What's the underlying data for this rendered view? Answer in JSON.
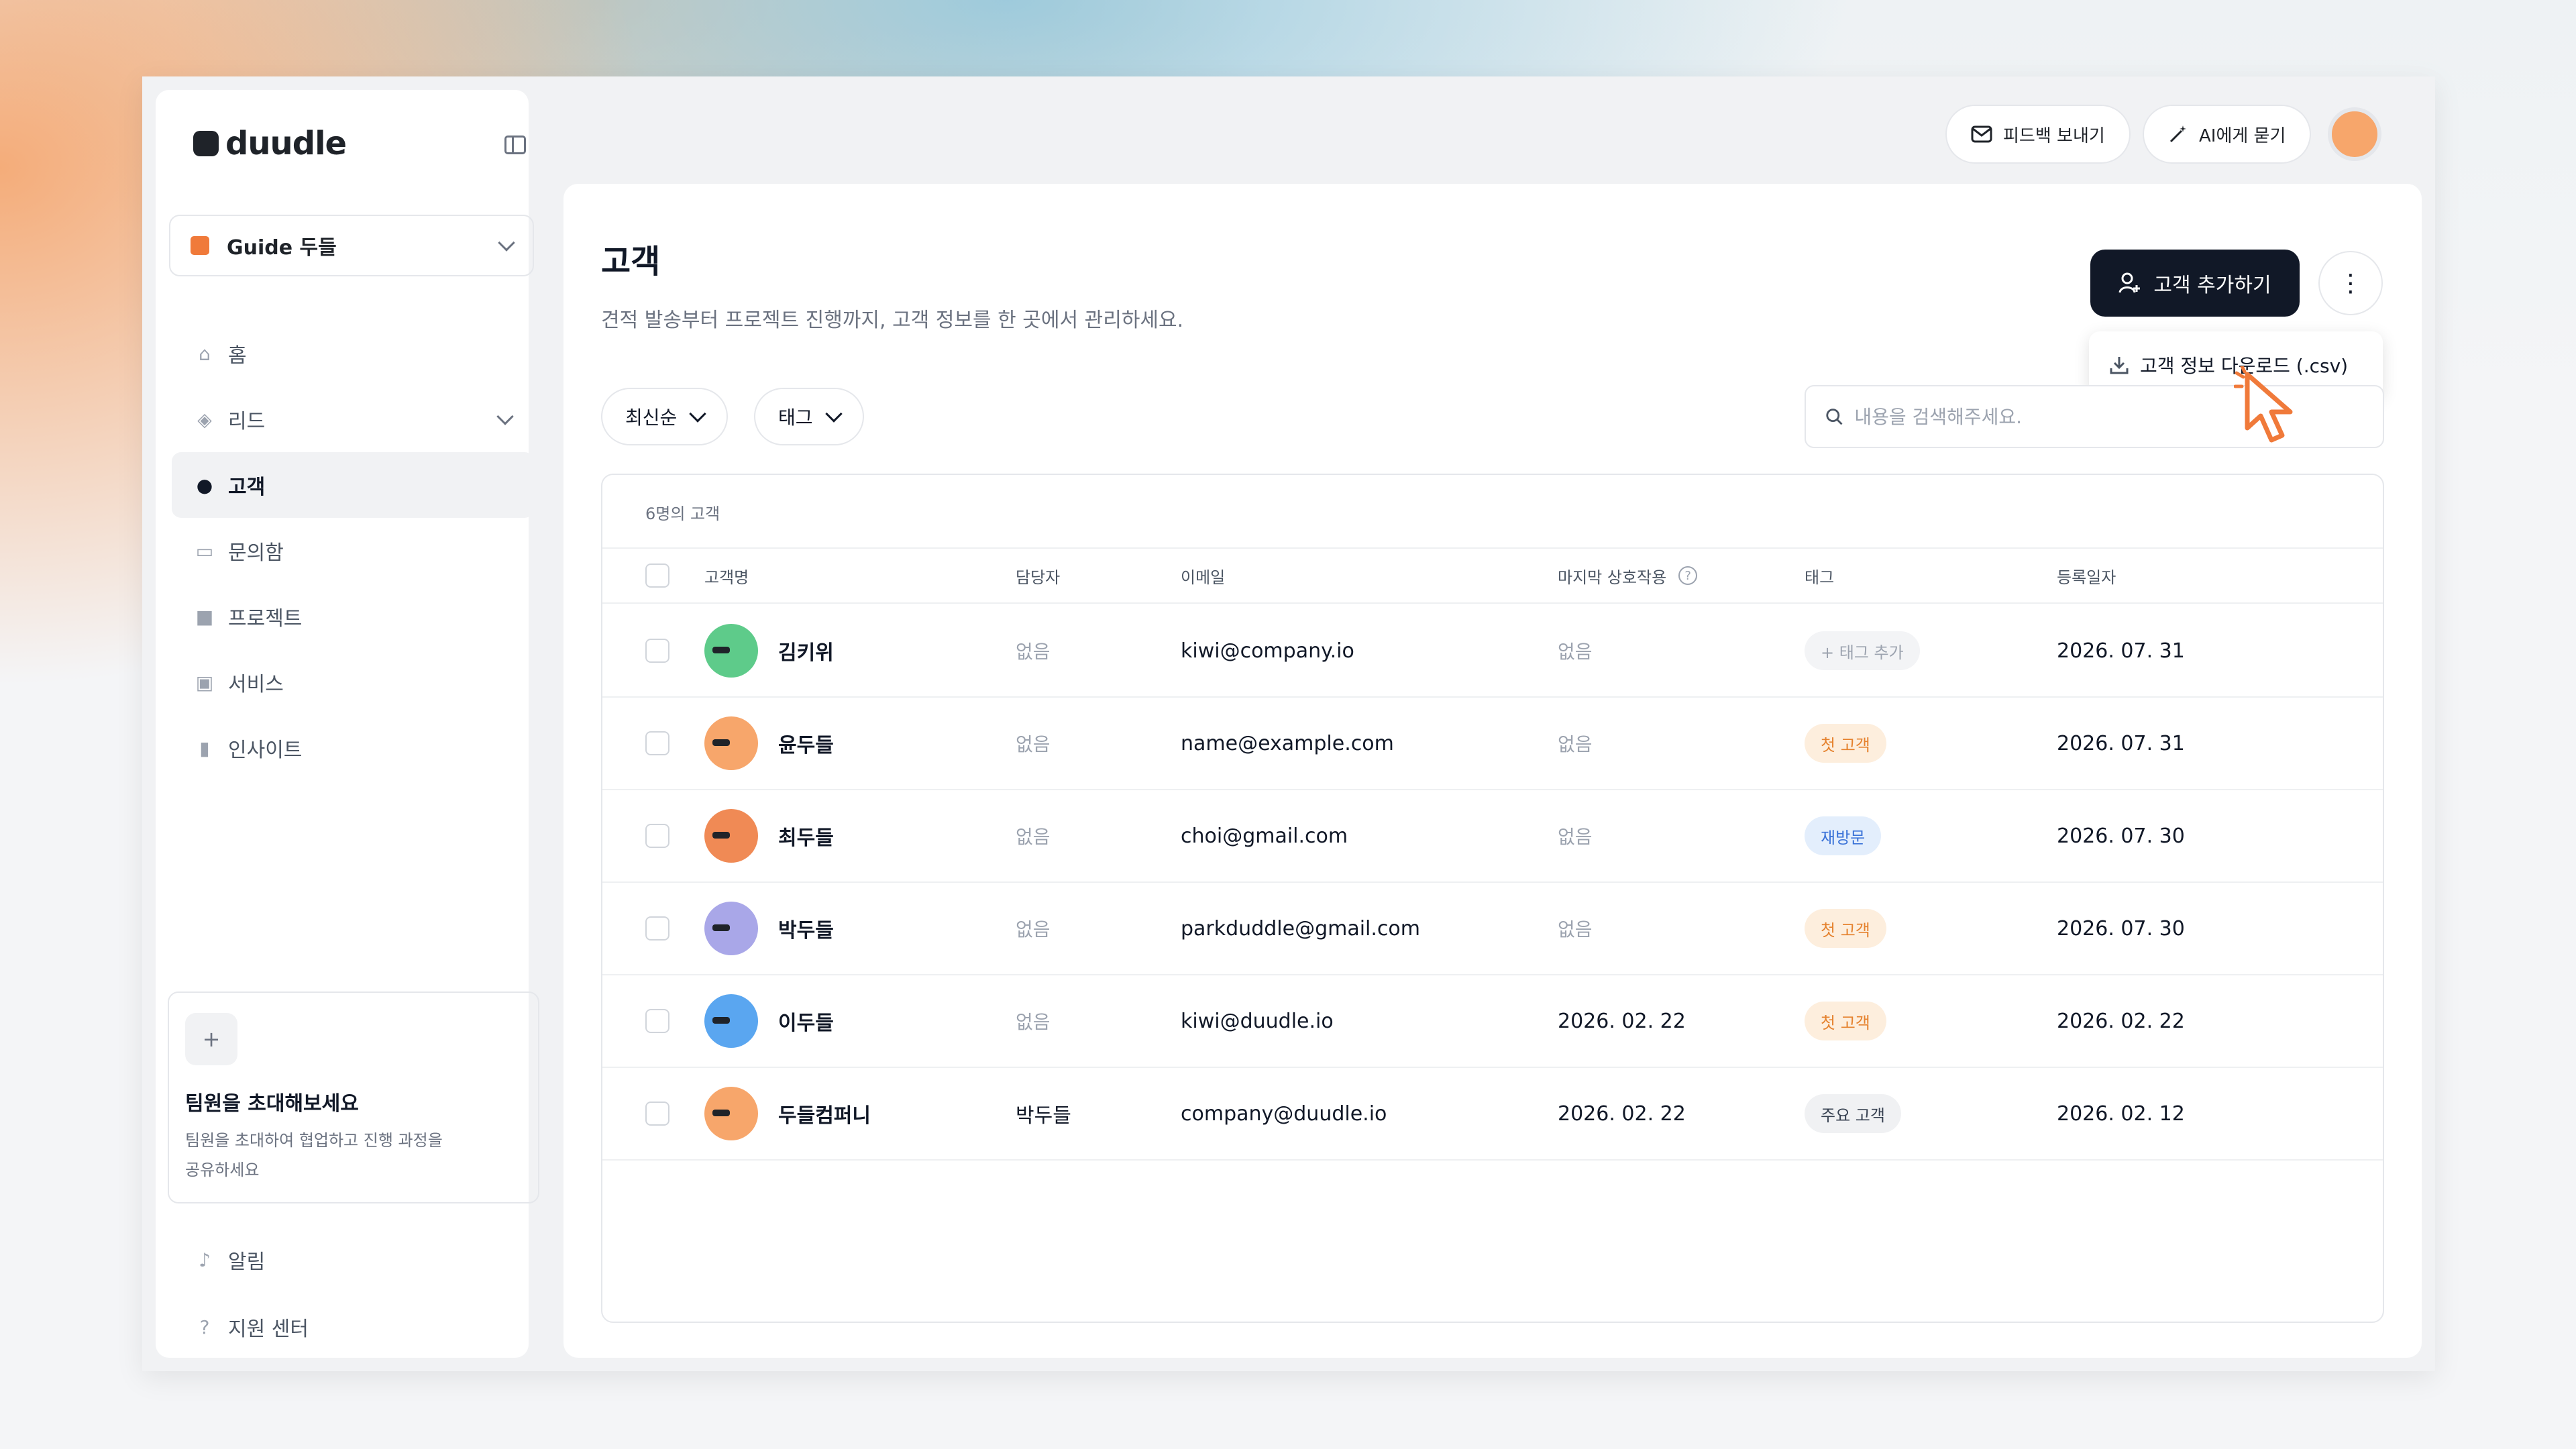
{
  "app": {
    "logo_text": "duudle"
  },
  "workspace": {
    "name": "Guide 두들"
  },
  "sidebar": {
    "items": [
      {
        "label": "홈",
        "icon": "home-icon",
        "glyph": "⌂"
      },
      {
        "label": "리드",
        "icon": "magnet-icon",
        "glyph": "◈"
      },
      {
        "label": "고객",
        "icon": "user-icon",
        "glyph": "●"
      },
      {
        "label": "문의함",
        "icon": "inbox-icon",
        "glyph": "▭"
      },
      {
        "label": "프로젝트",
        "icon": "folder-icon",
        "glyph": "■"
      },
      {
        "label": "서비스",
        "icon": "briefcase-icon",
        "glyph": "▣"
      },
      {
        "label": "인사이트",
        "icon": "bar-chart-icon",
        "glyph": "▮"
      }
    ],
    "invite": {
      "title": "팀원을 초대해보세요",
      "desc_line1": "팀원을 초대하여 협업하고 진행 과정을",
      "desc_line2": "공유하세요"
    },
    "bottom": [
      {
        "label": "알림",
        "icon": "bell-icon",
        "glyph": "♪"
      },
      {
        "label": "지원 센터",
        "icon": "help-circle-icon",
        "glyph": "?"
      }
    ]
  },
  "topbar": {
    "feedback_label": "피드백 보내기",
    "ai_label": "AI에게 묻기"
  },
  "page": {
    "title": "고객",
    "description": "견적 발송부터 프로젝트 진행까지, 고객 정보를 한 곳에서 관리하세요.",
    "add_button": "고객 추가하기",
    "dropdown_item": "고객 정보 다운로드 (.csv)"
  },
  "filters": {
    "sort_label": "최신순",
    "tag_label": "태그"
  },
  "search": {
    "placeholder": "내용을 검색해주세요."
  },
  "table": {
    "count": "6명의 고객",
    "headers": {
      "name": "고객명",
      "owner": "담당자",
      "email": "이메일",
      "last": "마지막 상호작용",
      "tag": "태그",
      "date": "등록일자"
    },
    "rows": [
      {
        "name": "김키위",
        "owner": "없음",
        "email": "kiwi@company.io",
        "last": "없음",
        "tag": "+ 태그 추가",
        "date": "2026. 07. 31"
      },
      {
        "name": "윤두들",
        "owner": "없음",
        "email": "name@example.com",
        "last": "없음",
        "tag": "첫 고객",
        "date": "2026. 07. 31"
      },
      {
        "name": "최두들",
        "owner": "없음",
        "email": "choi@gmail.com",
        "last": "없음",
        "tag": "재방문",
        "date": "2026. 07. 30"
      },
      {
        "name": "박두들",
        "owner": "없음",
        "email": "parkduddle@gmail.com",
        "last": "없음",
        "tag": "첫 고객",
        "date": "2026. 07. 30"
      },
      {
        "name": "이두들",
        "owner": "없음",
        "email": "kiwi@duudle.io",
        "last": "2026. 02. 22",
        "tag": "첫 고객",
        "date": "2026. 02. 22"
      },
      {
        "name": "두들컴퍼니",
        "owner": "박두들",
        "email": "company@duudle.io",
        "last": "2026. 02. 22",
        "tag": "주요 고객",
        "date": "2026. 02. 12"
      }
    ]
  },
  "colors": {
    "primary": "#111827",
    "accent_orange": "#f07a3a",
    "tag_first_bg": "#fdeedd",
    "tag_first_fg": "#e5822e",
    "tag_revisit_bg": "#e3eefc",
    "tag_revisit_fg": "#3b73d8",
    "tag_main_bg": "#f0f1f3",
    "tag_main_fg": "#374151",
    "tag_add_bg": "#f3f4f6",
    "tag_add_fg": "#9ca3af"
  }
}
